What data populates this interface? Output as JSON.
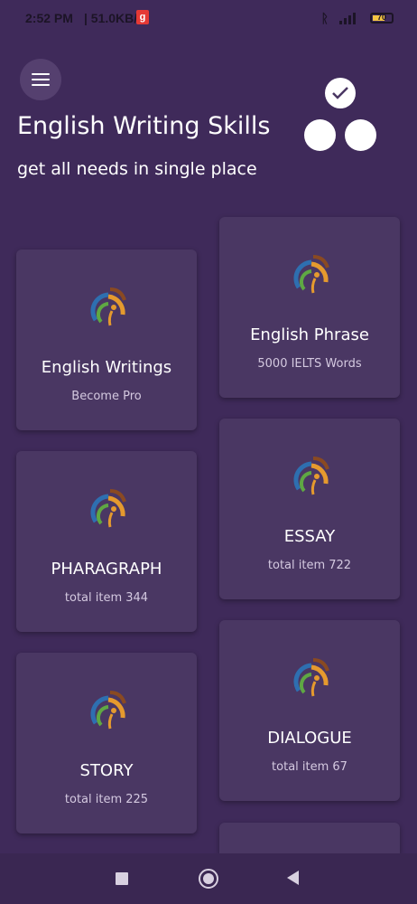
{
  "status": {
    "time": "2:52 PM",
    "speed": "| 51.0KB/s",
    "app_badge": "g",
    "battery_level": "70"
  },
  "header": {
    "title": "English Writing Skills",
    "subtitle": "get all needs in single place"
  },
  "cards": [
    {
      "title": "English Writings",
      "sub": "Become Pro"
    },
    {
      "title": "English Phrase",
      "sub": "5000 IELTS Words"
    },
    {
      "title": "PHARAGRAPH",
      "sub": "total item 344"
    },
    {
      "title": "ESSAY",
      "sub": "total item 722"
    },
    {
      "title": "STORY",
      "sub": "total item 225"
    },
    {
      "title": "DIALOGUE",
      "sub": "total item 67"
    },
    {
      "title": "",
      "sub": ""
    }
  ],
  "icons": {
    "menu": "hamburger-menu-icon",
    "check": "check-icon",
    "logo": "app-logo-icon",
    "nav_recent": "square-icon",
    "nav_home": "circle-icon",
    "nav_back": "triangle-back-icon"
  },
  "colors": {
    "background": "#3f2a5a",
    "card": "#4a3763",
    "logo_blue": "#2e6fb0",
    "logo_green": "#5fa843",
    "logo_orange": "#e59a2e",
    "logo_brown": "#8a4a22"
  }
}
